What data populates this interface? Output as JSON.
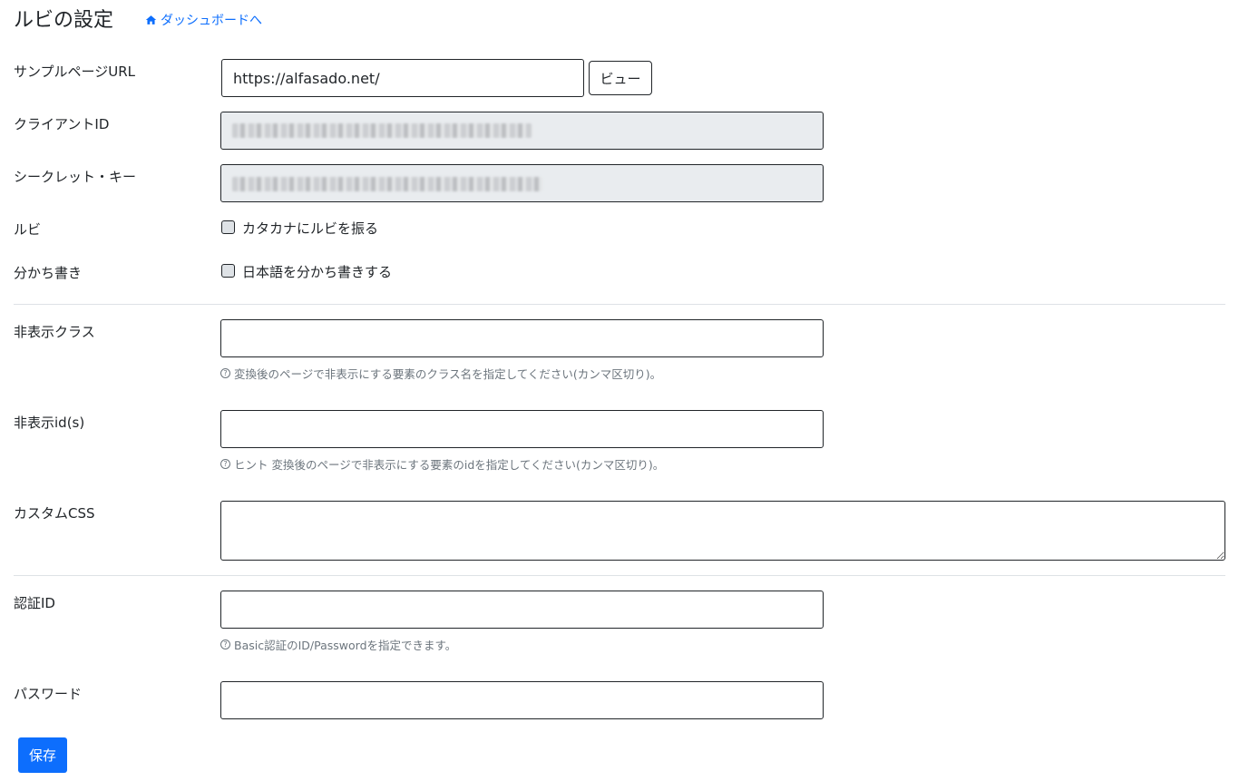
{
  "header": {
    "title": "ルビの設定",
    "dashboard_link": "ダッシュボードへ",
    "dashboard_icon": "home-icon",
    "link_color": "#0d6efd"
  },
  "form": {
    "sample_url": {
      "label": "サンプルページURL",
      "value": "https://alfasado.net/",
      "view_button": "ビュー"
    },
    "client_id": {
      "label": "クライアントID"
    },
    "secret_key": {
      "label": "シークレット・キー"
    },
    "ruby": {
      "label": "ルビ",
      "checkbox_label": "カタカナにルビを振る",
      "checked": false
    },
    "wakachi": {
      "label": "分かち書き",
      "checkbox_label": "日本語を分かち書きする",
      "checked": false
    },
    "hidden_class": {
      "label": "非表示クラス",
      "value": "",
      "hint": "変換後のページで非表示にする要素のクラス名を指定してください(カンマ区切り)。",
      "hint_icon": "?"
    },
    "hidden_ids": {
      "label": "非表示id(s)",
      "value": "",
      "hint": "ヒント 変換後のページで非表示にする要素のidを指定してください(カンマ区切り)。",
      "hint_icon": "?"
    },
    "custom_css": {
      "label": "カスタムCSS",
      "value": ""
    },
    "auth_id": {
      "label": "認証ID",
      "value": "",
      "hint": "Basic認証のID/Passwordを指定できます。",
      "hint_icon": "?"
    },
    "password": {
      "label": "パスワード",
      "value": ""
    },
    "save_button": "保存",
    "save_color": "#0d6efd"
  }
}
